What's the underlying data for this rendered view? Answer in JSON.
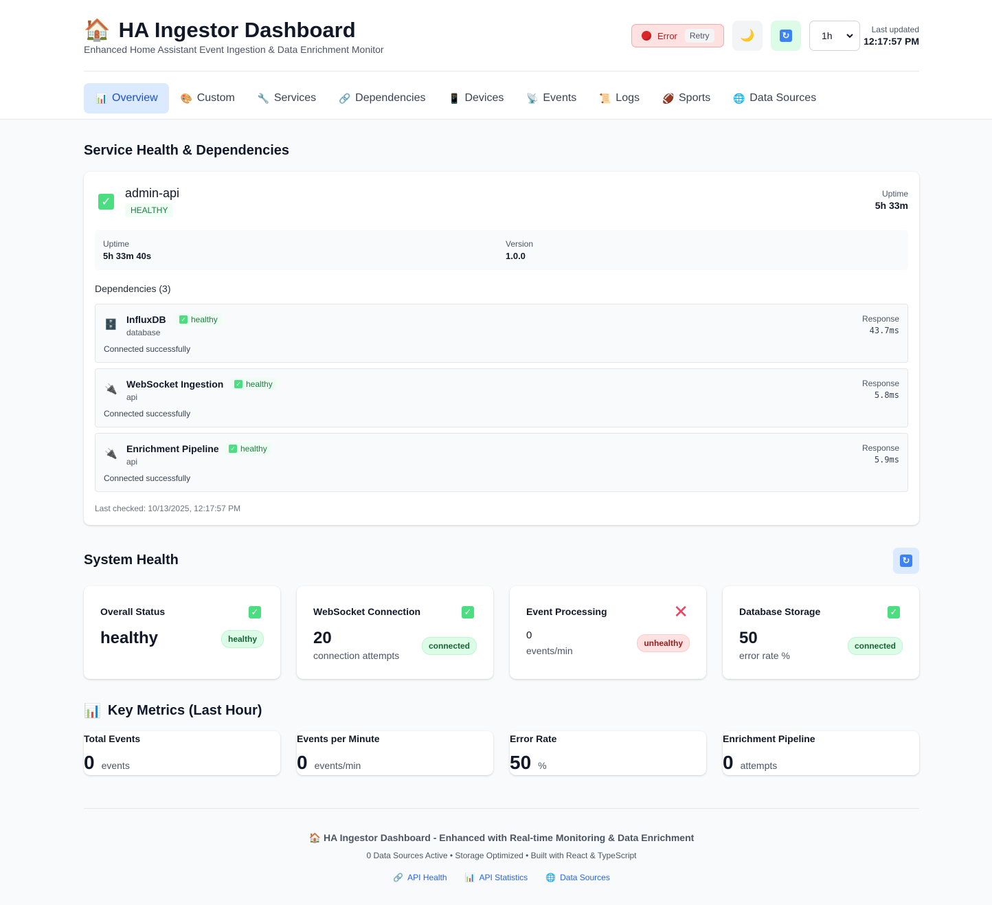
{
  "header": {
    "icon": "house-icon",
    "title": "HA Ingestor Dashboard",
    "subtitle": "Enhanced Home Assistant Event Ingestion & Data Enrichment Monitor",
    "status_label": "Error",
    "retry_label": "Retry",
    "time_range": "1h",
    "last_updated_label": "Last updated",
    "last_updated_time": "12:17:57 PM"
  },
  "tabs": [
    {
      "icon": "chart-icon",
      "label": "Overview",
      "active": true
    },
    {
      "icon": "palette-icon",
      "label": "Custom"
    },
    {
      "icon": "wrench-icon",
      "label": "Services"
    },
    {
      "icon": "link-icon",
      "label": "Dependencies"
    },
    {
      "icon": "phone-icon",
      "label": "Devices"
    },
    {
      "icon": "satellite-icon",
      "label": "Events"
    },
    {
      "icon": "scroll-icon",
      "label": "Logs"
    },
    {
      "icon": "football-icon",
      "label": "Sports"
    },
    {
      "icon": "globe-icon",
      "label": "Data Sources"
    }
  ],
  "service_section": {
    "title": "Service Health & Dependencies",
    "service": {
      "name": "admin-api",
      "status": "HEALTHY",
      "uptime_label": "Uptime",
      "uptime_short": "5h 33m",
      "uptime_full": "5h 33m 40s",
      "version_label": "Version",
      "version": "1.0.0"
    },
    "dependencies_title": "Dependencies (3)",
    "dependencies": [
      {
        "icon": "database-icon",
        "name": "InfluxDB",
        "status": "healthy",
        "type": "database",
        "message": "Connected successfully",
        "response_label": "Response",
        "response": "43.7ms"
      },
      {
        "icon": "plug-icon",
        "name": "WebSocket Ingestion",
        "status": "healthy",
        "type": "api",
        "message": "Connected successfully",
        "response_label": "Response",
        "response": "5.8ms"
      },
      {
        "icon": "plug-icon",
        "name": "Enrichment Pipeline",
        "status": "healthy",
        "type": "api",
        "message": "Connected successfully",
        "response_label": "Response",
        "response": "5.9ms"
      }
    ],
    "last_checked": "Last checked: 10/13/2025, 12:17:57 PM"
  },
  "system_health": {
    "title": "System Health",
    "cards": [
      {
        "title": "Overall Status",
        "value": "healthy",
        "sub": "",
        "badge": "healthy",
        "state": "ok"
      },
      {
        "title": "WebSocket Connection",
        "value": "20",
        "sub": "connection attempts",
        "badge": "connected",
        "state": "ok"
      },
      {
        "title": "Event Processing",
        "value": "0",
        "sub": "events/min",
        "badge": "unhealthy",
        "state": "bad"
      },
      {
        "title": "Database Storage",
        "value": "50",
        "sub": "error rate %",
        "badge": "connected",
        "state": "ok"
      }
    ]
  },
  "key_metrics": {
    "title": "Key Metrics (Last Hour)",
    "cards": [
      {
        "label": "Total Events",
        "value": "0",
        "unit": "events"
      },
      {
        "label": "Events per Minute",
        "value": "0",
        "unit": "events/min"
      },
      {
        "label": "Error Rate",
        "value": "50",
        "unit": "%"
      },
      {
        "label": "Enrichment Pipeline",
        "value": "0",
        "unit": "attempts"
      }
    ]
  },
  "footer": {
    "title": "HA Ingestor Dashboard - Enhanced with Real-time Monitoring & Data Enrichment",
    "subtitle": "0 Data Sources Active • Storage Optimized • Built with React & TypeScript",
    "links": [
      {
        "icon": "link-icon",
        "label": "API Health"
      },
      {
        "icon": "chart-icon",
        "label": "API Statistics"
      },
      {
        "icon": "globe-icon",
        "label": "Data Sources"
      }
    ]
  }
}
